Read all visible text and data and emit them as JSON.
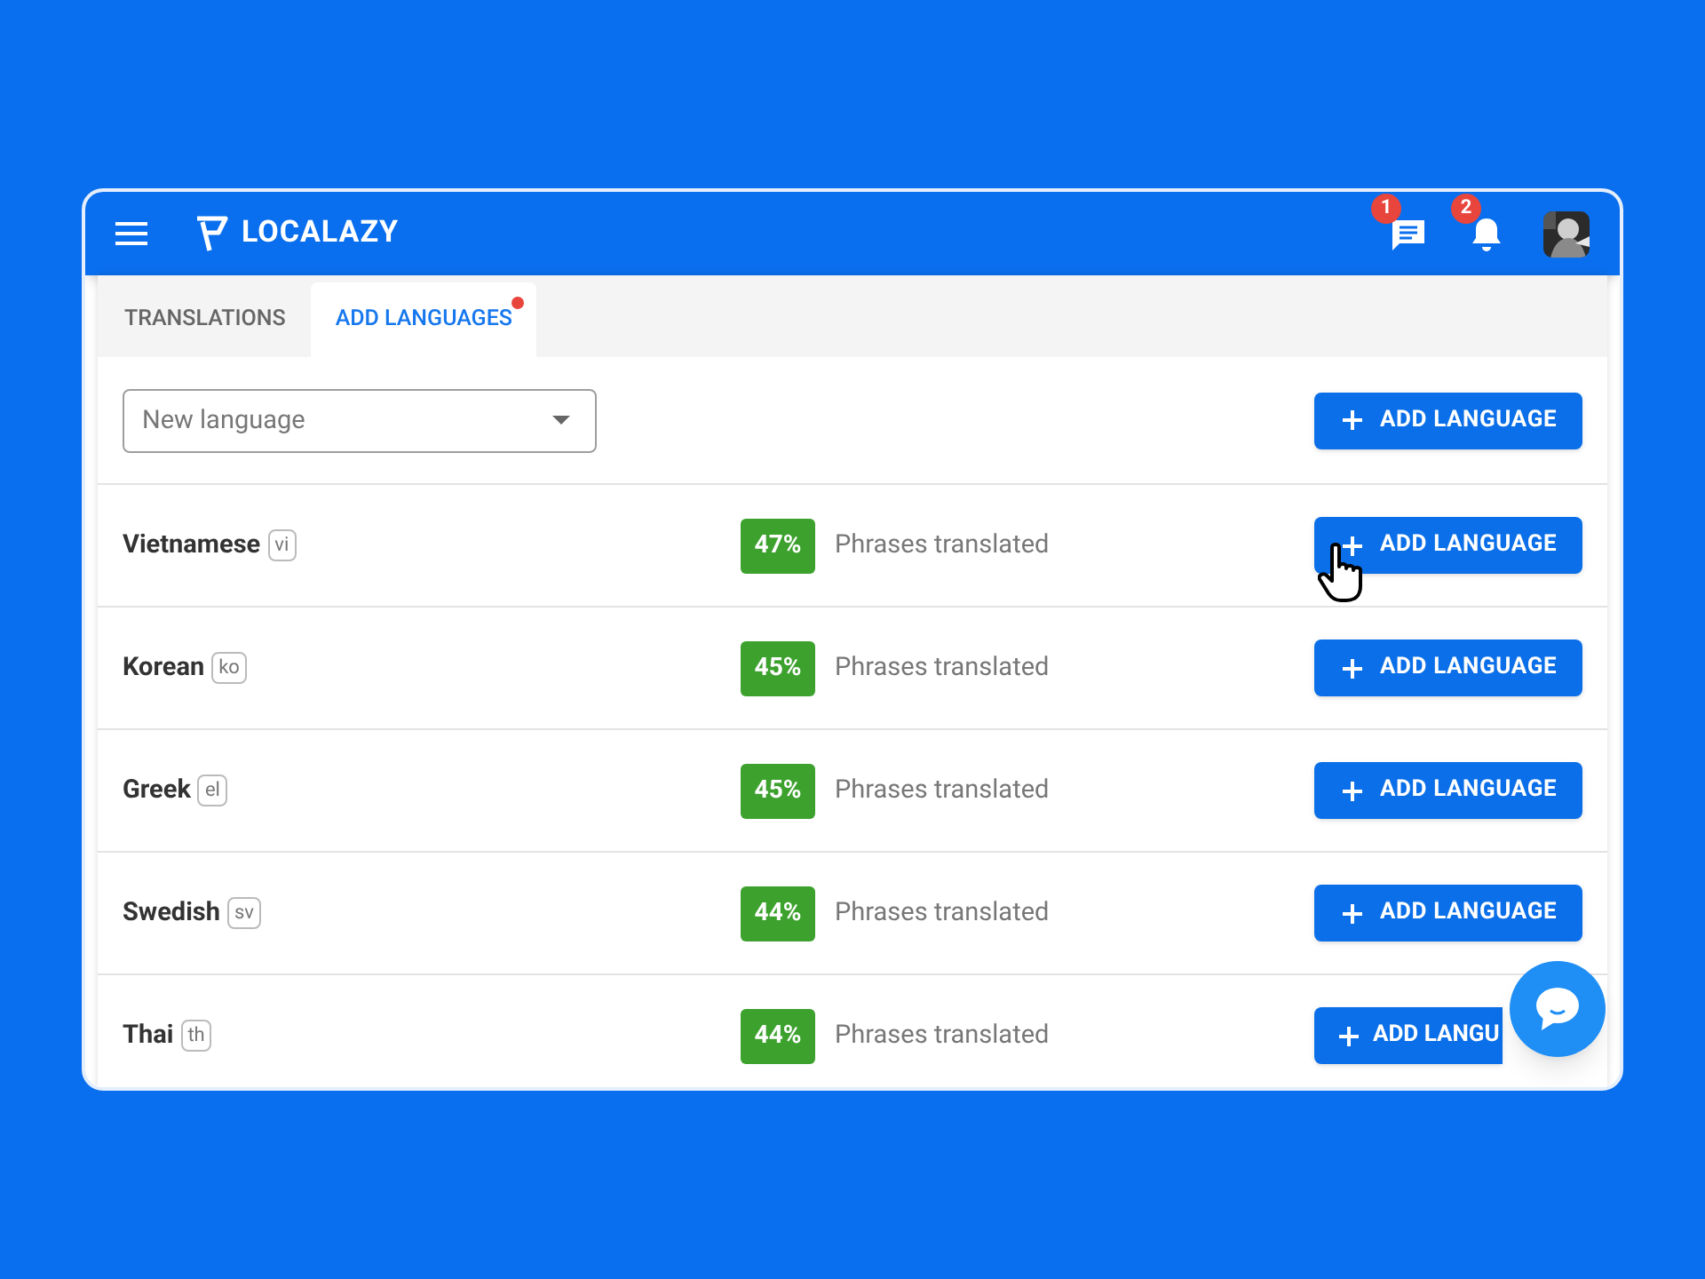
{
  "header": {
    "brand": "LOCALAZY",
    "messages_badge": "1",
    "notifications_badge": "2"
  },
  "tabs": [
    {
      "label": "TRANSLATIONS",
      "selected": false,
      "dot": false
    },
    {
      "label": "ADD LANGUAGES",
      "selected": true,
      "dot": true
    }
  ],
  "toolbar": {
    "select": {
      "placeholder": "New language"
    },
    "button": "ADD LANGUAGE"
  },
  "languages": [
    {
      "name": "Vietnamese",
      "code": "vi",
      "percent": "47%",
      "caption": "Phrases translated",
      "button": "ADD LANGUAGE",
      "hovered": true
    },
    {
      "name": "Korean",
      "code": "ko",
      "percent": "45%",
      "caption": "Phrases translated",
      "button": "ADD LANGUAGE",
      "hovered": false
    },
    {
      "name": "Greek",
      "code": "el",
      "percent": "45%",
      "caption": "Phrases translated",
      "button": "ADD LANGUAGE",
      "hovered": false
    },
    {
      "name": "Swedish",
      "code": "sv",
      "percent": "44%",
      "caption": "Phrases translated",
      "button": "ADD LANGUAGE",
      "hovered": false
    },
    {
      "name": "Thai",
      "code": "th",
      "percent": "44%",
      "caption": "Phrases translated",
      "button": "ADD LANGU",
      "hovered": false,
      "covered": true
    }
  ]
}
